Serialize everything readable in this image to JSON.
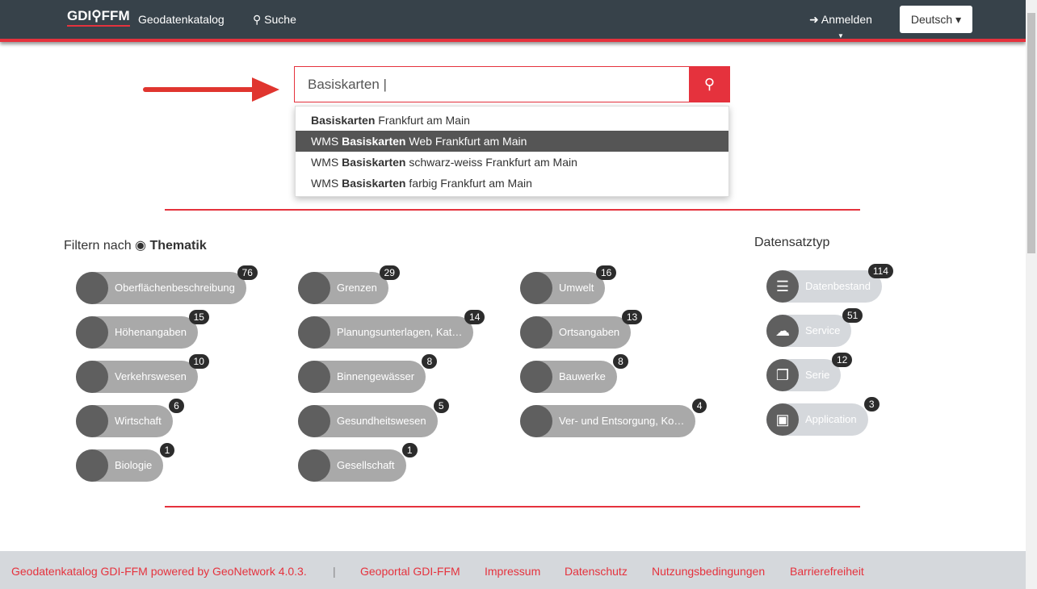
{
  "nav": {
    "logo": "GDI⚲FFM",
    "catalog": "Geodatenkatalog",
    "search": "Suche",
    "login": "Anmelden",
    "language": "Deutsch ▾"
  },
  "search": {
    "value": "Basiskarten",
    "icon": "search-icon"
  },
  "suggestions": [
    {
      "pre": "",
      "bold": "Basiskarten",
      "post": " Frankfurt am Main"
    },
    {
      "pre": "WMS ",
      "bold": "Basiskarten",
      "post": " Web Frankfurt am Main"
    },
    {
      "pre": "WMS ",
      "bold": "Basiskarten",
      "post": " schwarz-weiss Frankfurt am Main"
    },
    {
      "pre": "WMS ",
      "bold": "Basiskarten",
      "post": " farbig Frankfurt am Main"
    }
  ],
  "filter": {
    "label": "Filtern nach",
    "option": "Thematik"
  },
  "topics": [
    {
      "label": "Oberflächenbeschreibung",
      "count": "76"
    },
    {
      "label": "Höhenangaben",
      "count": "15"
    },
    {
      "label": "Verkehrswesen",
      "count": "10"
    },
    {
      "label": "Wirtschaft",
      "count": "6"
    },
    {
      "label": "Biologie",
      "count": "1"
    },
    {
      "label": "Grenzen",
      "count": "29"
    },
    {
      "label": "Planungsunterlagen, Kat…",
      "count": "14"
    },
    {
      "label": "Binnengewässer",
      "count": "8"
    },
    {
      "label": "Gesundheitswesen",
      "count": "5"
    },
    {
      "label": "Gesellschaft",
      "count": "1"
    },
    {
      "label": "Umwelt",
      "count": "16"
    },
    {
      "label": "Ortsangaben",
      "count": "13"
    },
    {
      "label": "Bauwerke",
      "count": "8"
    },
    {
      "label": "Ver- und Entsorgung, Ko…",
      "count": "4"
    }
  ],
  "types": {
    "title": "Datensatztyp",
    "items": [
      {
        "label": "Datenbestand",
        "count": "114",
        "icon": "database-icon"
      },
      {
        "label": "Service",
        "count": "51",
        "icon": "cloud-icon"
      },
      {
        "label": "Serie",
        "count": "12",
        "icon": "copy-icon"
      },
      {
        "label": "Application",
        "count": "3",
        "icon": "save-icon"
      }
    ]
  },
  "footer": {
    "powered": "Geodatenkatalog GDI-FFM powered by GeoNetwork 4.0.3.",
    "sep": "|",
    "links": [
      "Geoportal GDI-FFM",
      "Impressum",
      "Datenschutz",
      "Nutzungsbedingungen",
      "Barrierefreiheit"
    ]
  }
}
